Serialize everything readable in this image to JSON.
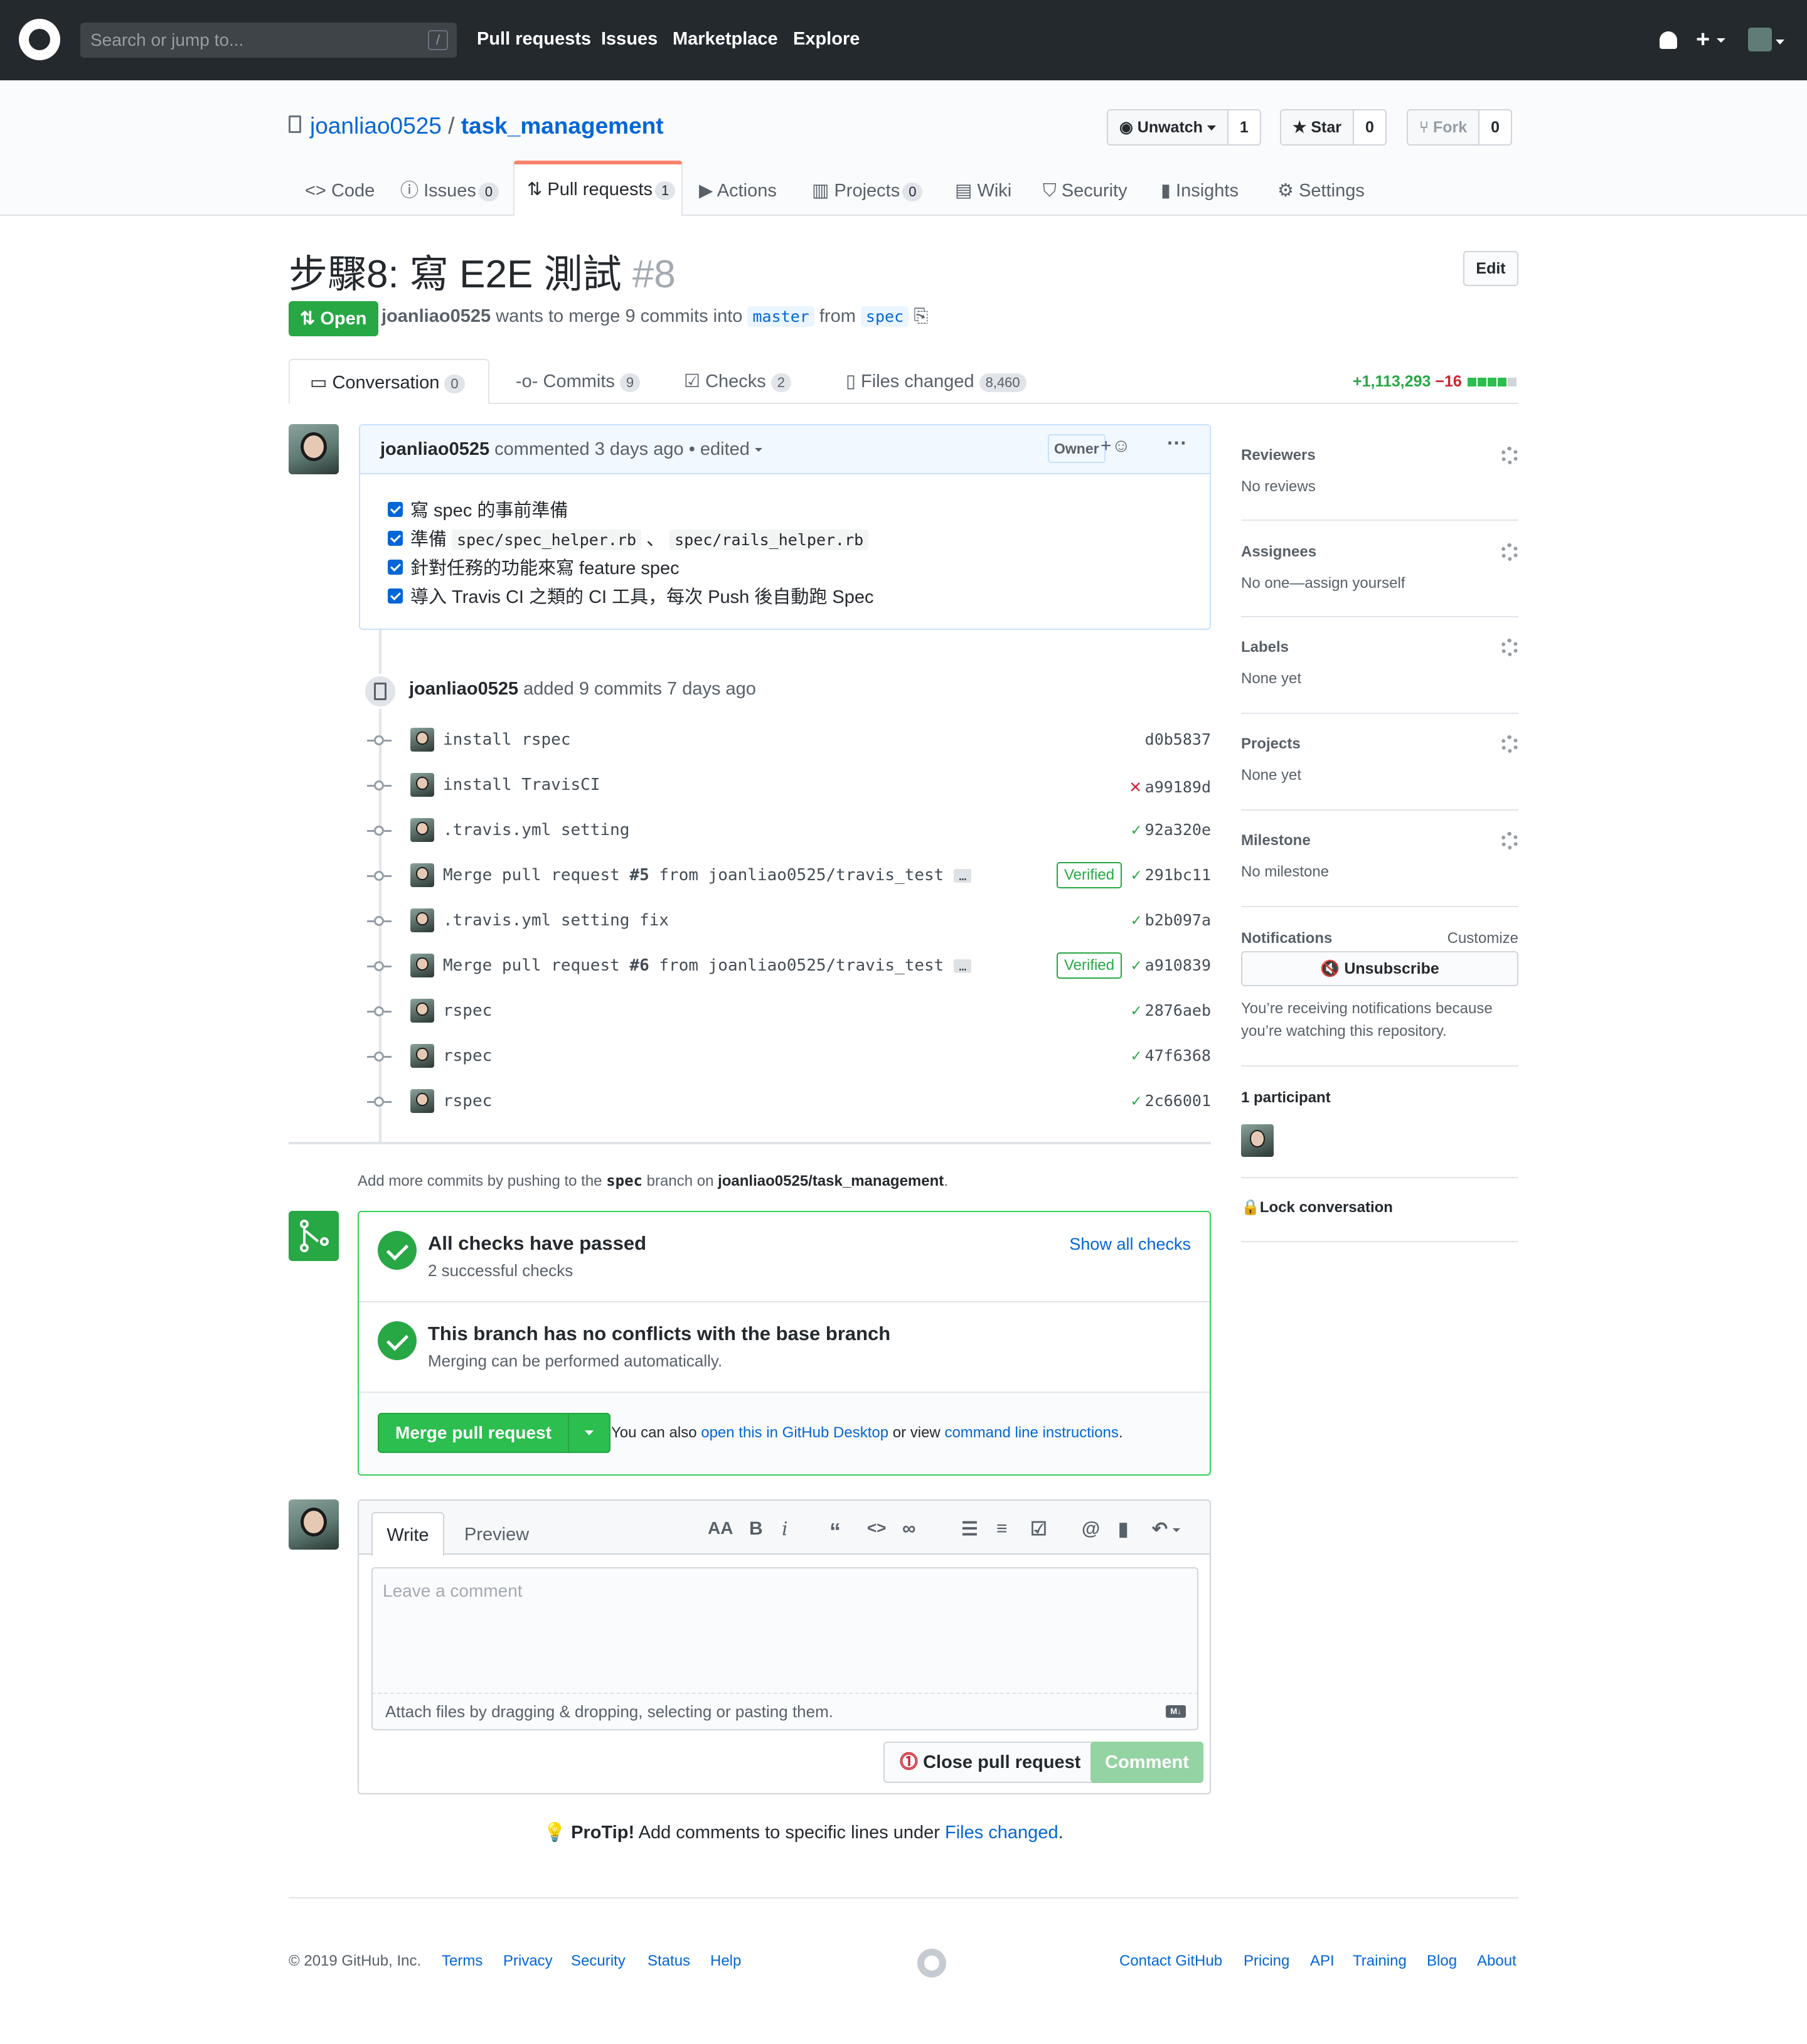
{
  "header": {
    "search_placeholder": "Search or jump to...",
    "slash_key": "/",
    "nav": [
      "Pull requests",
      "Issues",
      "Marketplace",
      "Explore"
    ]
  },
  "repo": {
    "owner": "joanliao0525",
    "separator": "/",
    "name": "task_management",
    "watch_label": "Unwatch",
    "watch_count": "1",
    "star_label": "Star",
    "star_count": "0",
    "fork_label": "Fork",
    "fork_count": "0"
  },
  "repo_tabs": [
    {
      "label": "Code",
      "icon": "code-icon",
      "count": ""
    },
    {
      "label": "Issues",
      "icon": "issue-icon",
      "count": "0"
    },
    {
      "label": "Pull requests",
      "icon": "pull-request-icon",
      "count": "1"
    },
    {
      "label": "Actions",
      "icon": "play-icon",
      "count": ""
    },
    {
      "label": "Projects",
      "icon": "project-icon",
      "count": "0"
    },
    {
      "label": "Wiki",
      "icon": "book-icon",
      "count": ""
    },
    {
      "label": "Security",
      "icon": "shield-icon",
      "count": ""
    },
    {
      "label": "Insights",
      "icon": "graph-icon",
      "count": ""
    },
    {
      "label": "Settings",
      "icon": "gear-icon",
      "count": ""
    }
  ],
  "pr": {
    "title": "步驟8: 寫 E2E 測試",
    "number": "#8",
    "edit_label": "Edit",
    "state": "Open",
    "author": "joanliao0525",
    "merge_text": "wants to merge 9 commits into",
    "base_branch": "master",
    "from_text": "from",
    "head_branch": "spec"
  },
  "pr_tabs": [
    {
      "label": "Conversation",
      "count": "0"
    },
    {
      "label": "Commits",
      "count": "9"
    },
    {
      "label": "Checks",
      "count": "2"
    },
    {
      "label": "Files changed",
      "count": "8,460"
    }
  ],
  "diffstat": {
    "additions": "+1,113,293",
    "deletions": "−16",
    "add_color": "#28a745",
    "del_color": "#cb2431"
  },
  "comment": {
    "author": "joanliao0525",
    "action": "commented 3 days ago",
    "edited": "• edited",
    "owner_badge": "Owner",
    "tasks": [
      {
        "pre": "寫 spec 的事前準備",
        "code1": "",
        "mid": "",
        "code2": "",
        "post": ""
      },
      {
        "pre": "準備 ",
        "code1": "spec/spec_helper.rb",
        "mid": " 、 ",
        "code2": "spec/rails_helper.rb",
        "post": ""
      },
      {
        "pre": "針對任務的功能來寫 feature spec",
        "code1": "",
        "mid": "",
        "code2": "",
        "post": ""
      },
      {
        "pre": "導入 Travis CI 之類的 CI 工具，每次 Push 後自動跑 Spec",
        "code1": "",
        "mid": "",
        "code2": "",
        "post": ""
      }
    ]
  },
  "timeline": {
    "author": "joanliao0525",
    "text": "added 9 commits 7 days ago",
    "commits": [
      {
        "pre": "install rspec",
        "bold": "",
        "post": "",
        "status": "",
        "verified": "",
        "sha": "d0b5837",
        "ellipsis": ""
      },
      {
        "pre": "install TravisCI",
        "bold": "",
        "post": "",
        "status": "✕",
        "verified": "",
        "sha": "a99189d",
        "ellipsis": ""
      },
      {
        "pre": ".travis.yml setting",
        "bold": "",
        "post": "",
        "status": "✓",
        "verified": "",
        "sha": "92a320e",
        "ellipsis": ""
      },
      {
        "pre": "Merge pull request ",
        "bold": "#5",
        "post": " from joanliao0525/travis_test",
        "status": "✓",
        "verified": "Verified",
        "sha": "291bc11",
        "ellipsis": "…"
      },
      {
        "pre": ".travis.yml setting fix",
        "bold": "",
        "post": "",
        "status": "✓",
        "verified": "",
        "sha": "b2b097a",
        "ellipsis": ""
      },
      {
        "pre": "Merge pull request ",
        "bold": "#6",
        "post": " from joanliao0525/travis_test",
        "status": "✓",
        "verified": "Verified",
        "sha": "a910839",
        "ellipsis": "…"
      },
      {
        "pre": "rspec",
        "bold": "",
        "post": "",
        "status": "✓",
        "verified": "",
        "sha": "2876aeb",
        "ellipsis": ""
      },
      {
        "pre": "rspec",
        "bold": "",
        "post": "",
        "status": "✓",
        "verified": "",
        "sha": "47f6368",
        "ellipsis": ""
      },
      {
        "pre": "rspec",
        "bold": "",
        "post": "",
        "status": "✓",
        "verified": "",
        "sha": "2c66001",
        "ellipsis": ""
      }
    ]
  },
  "addmore": {
    "pre": "Add more commits by pushing to the",
    "branch": "spec",
    "mid": "branch on",
    "repo": "joanliao0525/task_management",
    "post": "."
  },
  "merge": {
    "checks_title": "All checks have passed",
    "checks_sub": "2 successful checks",
    "show_all": "Show all checks",
    "conflict_title": "This branch has no conflicts with the base branch",
    "conflict_sub": "Merging can be performed automatically.",
    "merge_button": "Merge pull request",
    "also_pre": "You can also",
    "desktop_link": "open this in GitHub Desktop",
    "or_view": "or view",
    "cli_link": "command line instructions",
    "also_post": "."
  },
  "form": {
    "write_tab": "Write",
    "preview_tab": "Preview",
    "placeholder": "Leave a comment",
    "attach_text": "Attach files by dragging & dropping, selecting or pasting them.",
    "close_button": "Close pull request",
    "comment_button": "Comment"
  },
  "protip": {
    "label": "ProTip!",
    "text": "Add comments to specific lines under",
    "link": "Files changed",
    "post": "."
  },
  "sidebar": {
    "reviewers": {
      "title": "Reviewers",
      "value": "No reviews"
    },
    "assignees": {
      "title": "Assignees",
      "value": "No one—assign yourself"
    },
    "labels": {
      "title": "Labels",
      "value": "None yet"
    },
    "projects": {
      "title": "Projects",
      "value": "None yet"
    },
    "milestone": {
      "title": "Milestone",
      "value": "No milestone"
    },
    "notifications": {
      "title": "Notifications",
      "customize": "Customize",
      "button": "Unsubscribe",
      "reason_line1": "You’re receiving notifications because",
      "reason_line2": "you’re watching this repository."
    },
    "participants": "1 participant",
    "lock": "Lock conversation"
  },
  "footer": {
    "copyright": "© 2019 GitHub, Inc.",
    "left_links": [
      "Terms",
      "Privacy",
      "Security",
      "Status",
      "Help"
    ],
    "right_links": [
      "Contact GitHub",
      "Pricing",
      "API",
      "Training",
      "Blog",
      "About"
    ]
  }
}
